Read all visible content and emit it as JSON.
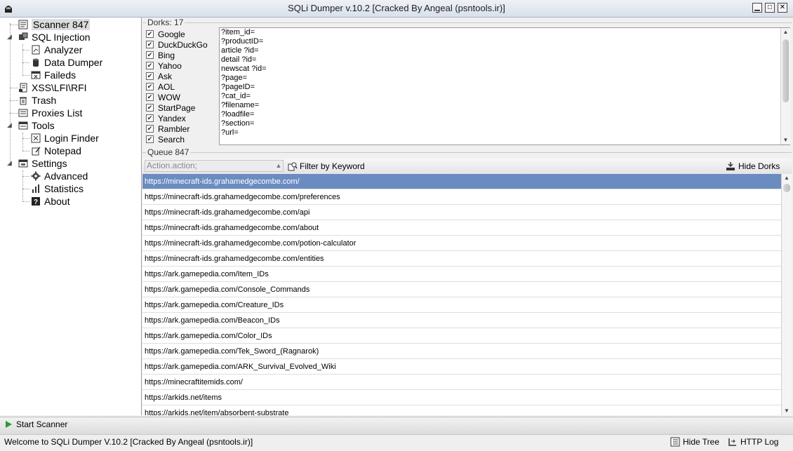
{
  "window": {
    "title": "SQLi Dumper v.10.2 [Cracked By Angeal (psntools.ir)]",
    "minimize": "▁",
    "maximize": "□",
    "close": "✕"
  },
  "tree": {
    "scanner": {
      "label": "Scanner",
      "count": "847"
    },
    "sql_injection": "SQL Injection",
    "analyzer": "Analyzer",
    "data_dumper": "Data Dumper",
    "faileds": "Faileds",
    "xss": "XSS\\LFI\\RFI",
    "trash": "Trash",
    "proxies": "Proxies List",
    "tools": "Tools",
    "login_finder": "Login Finder",
    "notepad": "Notepad",
    "settings": "Settings",
    "advanced": "Advanced",
    "statistics": "Statistics",
    "about": "About"
  },
  "dorks": {
    "legend": "Dorks:",
    "count": "17",
    "engines": [
      "Google",
      "DuckDuckGo",
      "Bing",
      "Yahoo",
      "Ask",
      "AOL",
      "WOW",
      "StartPage",
      "Yandex",
      "Rambler",
      "Search"
    ],
    "items": [
      "?item_id=",
      "?productID=",
      "article ?id=",
      "detail ?id=",
      "newscat ?id=",
      "?page=",
      "?pageID=",
      "?cat_id=",
      "?filename=",
      "?loadfile=",
      "?section=",
      "?url="
    ]
  },
  "queue": {
    "legend": "Queue",
    "count": "847",
    "action_placeholder": "Action.action;",
    "filter_label": "Filter by Keyword",
    "hide_dorks_label": "Hide Dorks",
    "rows": [
      "https://minecraft-ids.grahamedgecombe.com/",
      "https://minecraft-ids.grahamedgecombe.com/preferences",
      "https://minecraft-ids.grahamedgecombe.com/api",
      "https://minecraft-ids.grahamedgecombe.com/about",
      "https://minecraft-ids.grahamedgecombe.com/potion-calculator",
      "https://minecraft-ids.grahamedgecombe.com/entities",
      "https://ark.gamepedia.com/Item_IDs",
      "https://ark.gamepedia.com/Console_Commands",
      "https://ark.gamepedia.com/Creature_IDs",
      "https://ark.gamepedia.com/Beacon_IDs",
      "https://ark.gamepedia.com/Color_IDs",
      "https://ark.gamepedia.com/Tek_Sword_(Ragnarok)",
      "https://ark.gamepedia.com/ARK_Survival_Evolved_Wiki",
      "https://minecraftitemids.com/",
      "https://arkids.net/items",
      "https://arkids.net/item/absorbent-substrate"
    ]
  },
  "bottom": {
    "start_label": "Start Scanner",
    "status_text": "Welcome to  SQLi Dumper V.10.2 [Cracked By Angeal (psntools.ir)]",
    "hide_tree_label": "Hide Tree",
    "http_log_label": "HTTP Log"
  },
  "colors": {
    "selection": "#6b8cc1",
    "start_icon": "#2e9b2e"
  }
}
